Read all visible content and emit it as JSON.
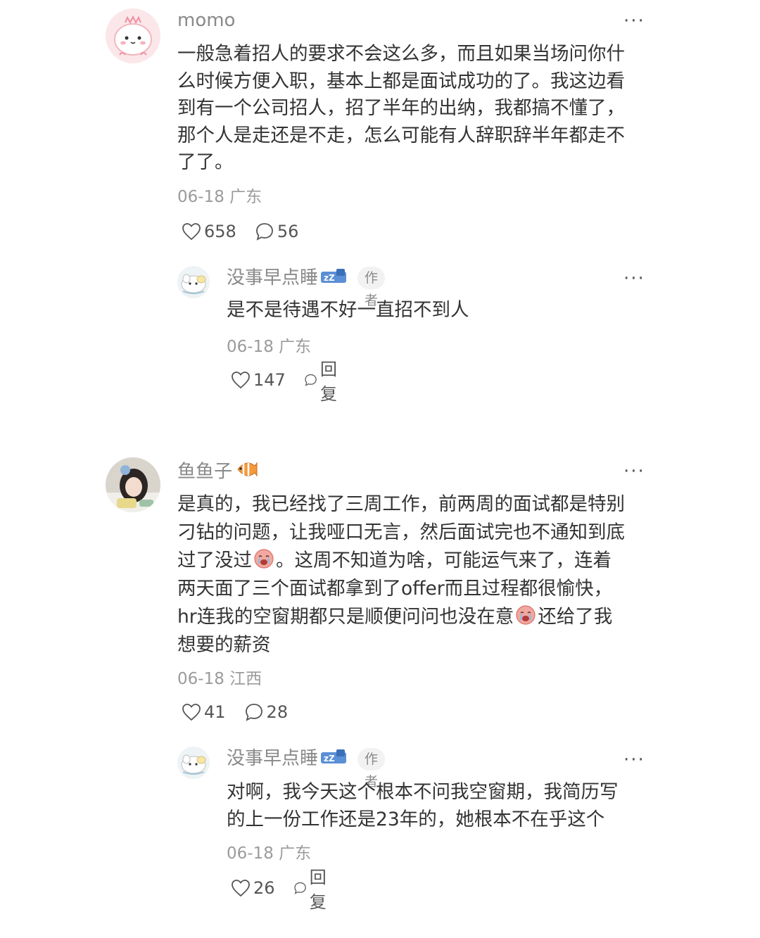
{
  "comments": [
    {
      "user": "momo",
      "more": "···",
      "lines": [
        "一般急着招人的要求不会这么多，而且如果当场问你什",
        "么时候方便入职，基本上都是面试成功的了。我这边看",
        "到有一个公司招人，招了半年的出纳，我都搞不懂了，",
        "那个人是走还是不走，怎么可能有人辞职辞半年都走不",
        "了了。"
      ],
      "date": "06-18 广东",
      "likes": "658",
      "replies": "56",
      "reply": {
        "user": "没事早点睡",
        "user_emoji": "sleep-zzz-emoji",
        "tag": "作者",
        "more": "···",
        "lines": [
          "是不是待遇不好一直招不到人"
        ],
        "date": "06-18 广东",
        "likes": "147",
        "reply_label": "回复"
      }
    },
    {
      "user": "鱼鱼子",
      "user_emoji": "fish-emoji",
      "more": "···",
      "lines": [
        "是真的，我已经找了三周工作，前两周的面试都是特别",
        "刁钻的问题，让我哑口无言，然后面试完也不通知到底",
        "过了没过",
        "。这周不知道为啥，可能运气来了，连着",
        "两天面了三个面试都拿到了offer而且过程都很愉快，",
        "hr连我的空窗期都只是顺便问问也没在意",
        "还给了我",
        "想要的薪资"
      ],
      "date": "06-18 江西",
      "likes": "41",
      "replies": "28",
      "reply": {
        "user": "没事早点睡",
        "user_emoji": "sleep-zzz-emoji",
        "tag": "作者",
        "more": "···",
        "lines": [
          "对啊，我今天这个根本不问我空窗期，我简历写",
          "的上一份工作还是23年的，她根本不在乎这个"
        ],
        "date": "06-18 广东",
        "likes": "26",
        "reply_label": "回复"
      }
    }
  ],
  "colors": {
    "text": "#333333",
    "meta": "#9b9b9b",
    "name": "#8a8a8a",
    "tag_bg": "#f2f2f2"
  }
}
